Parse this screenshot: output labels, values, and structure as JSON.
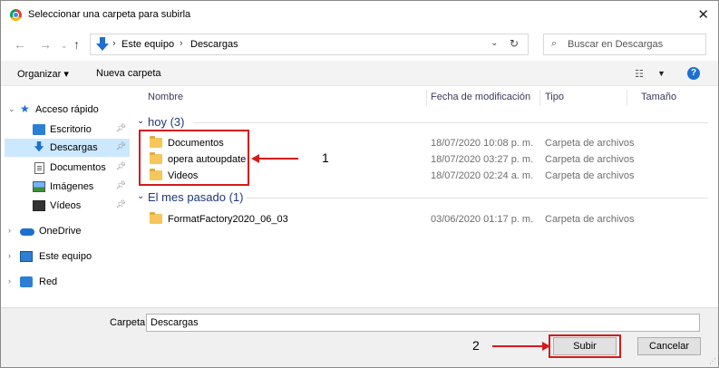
{
  "window": {
    "title": "Seleccionar una carpeta para subirla",
    "close_glyph": "✕"
  },
  "address": {
    "crumbs": [
      "Este equipo",
      "Descargas"
    ],
    "search_placeholder": "Buscar en Descargas"
  },
  "toolbar": {
    "organize_label": "Organizar ▾",
    "new_folder_label": "Nueva carpeta",
    "help_label": "?"
  },
  "sidebar": {
    "items": [
      {
        "label": "Acceso rápido",
        "icon": "star-icon"
      },
      {
        "label": "Escritorio",
        "icon": "desktop-icon"
      },
      {
        "label": "Descargas",
        "icon": "download-icon",
        "selected": true
      },
      {
        "label": "Documentos",
        "icon": "document-icon"
      },
      {
        "label": "Imágenes",
        "icon": "picture-icon"
      },
      {
        "label": "Vídeos",
        "icon": "video-icon"
      },
      {
        "label": "OneDrive",
        "icon": "cloud-icon"
      },
      {
        "label": "Este equipo",
        "icon": "computer-icon"
      },
      {
        "label": "Red",
        "icon": "network-icon"
      }
    ]
  },
  "columns": {
    "name": "Nombre",
    "modified": "Fecha de modificación",
    "type": "Tipo",
    "size": "Tamaño"
  },
  "groups": [
    {
      "label": "hoy (3)",
      "files": [
        {
          "name": "Documentos",
          "modified": "18/07/2020 10:08 p. m.",
          "type": "Carpeta de archivos"
        },
        {
          "name": "opera autoupdate",
          "modified": "18/07/2020 03:27 p. m.",
          "type": "Carpeta de archivos"
        },
        {
          "name": "Videos",
          "modified": "18/07/2020 02:24 a. m.",
          "type": "Carpeta de archivos"
        }
      ]
    },
    {
      "label": "El mes pasado (1)",
      "files": [
        {
          "name": "FormatFactory2020_06_03",
          "modified": "03/06/2020 01:17 p. m.",
          "type": "Carpeta de archivos"
        }
      ]
    }
  ],
  "annotations": {
    "one": "1",
    "two": "2",
    "color": "#d41a1a"
  },
  "footer": {
    "folder_label": "Carpeta:",
    "folder_value": "Descargas",
    "submit_label": "Subir",
    "cancel_label": "Cancelar"
  }
}
